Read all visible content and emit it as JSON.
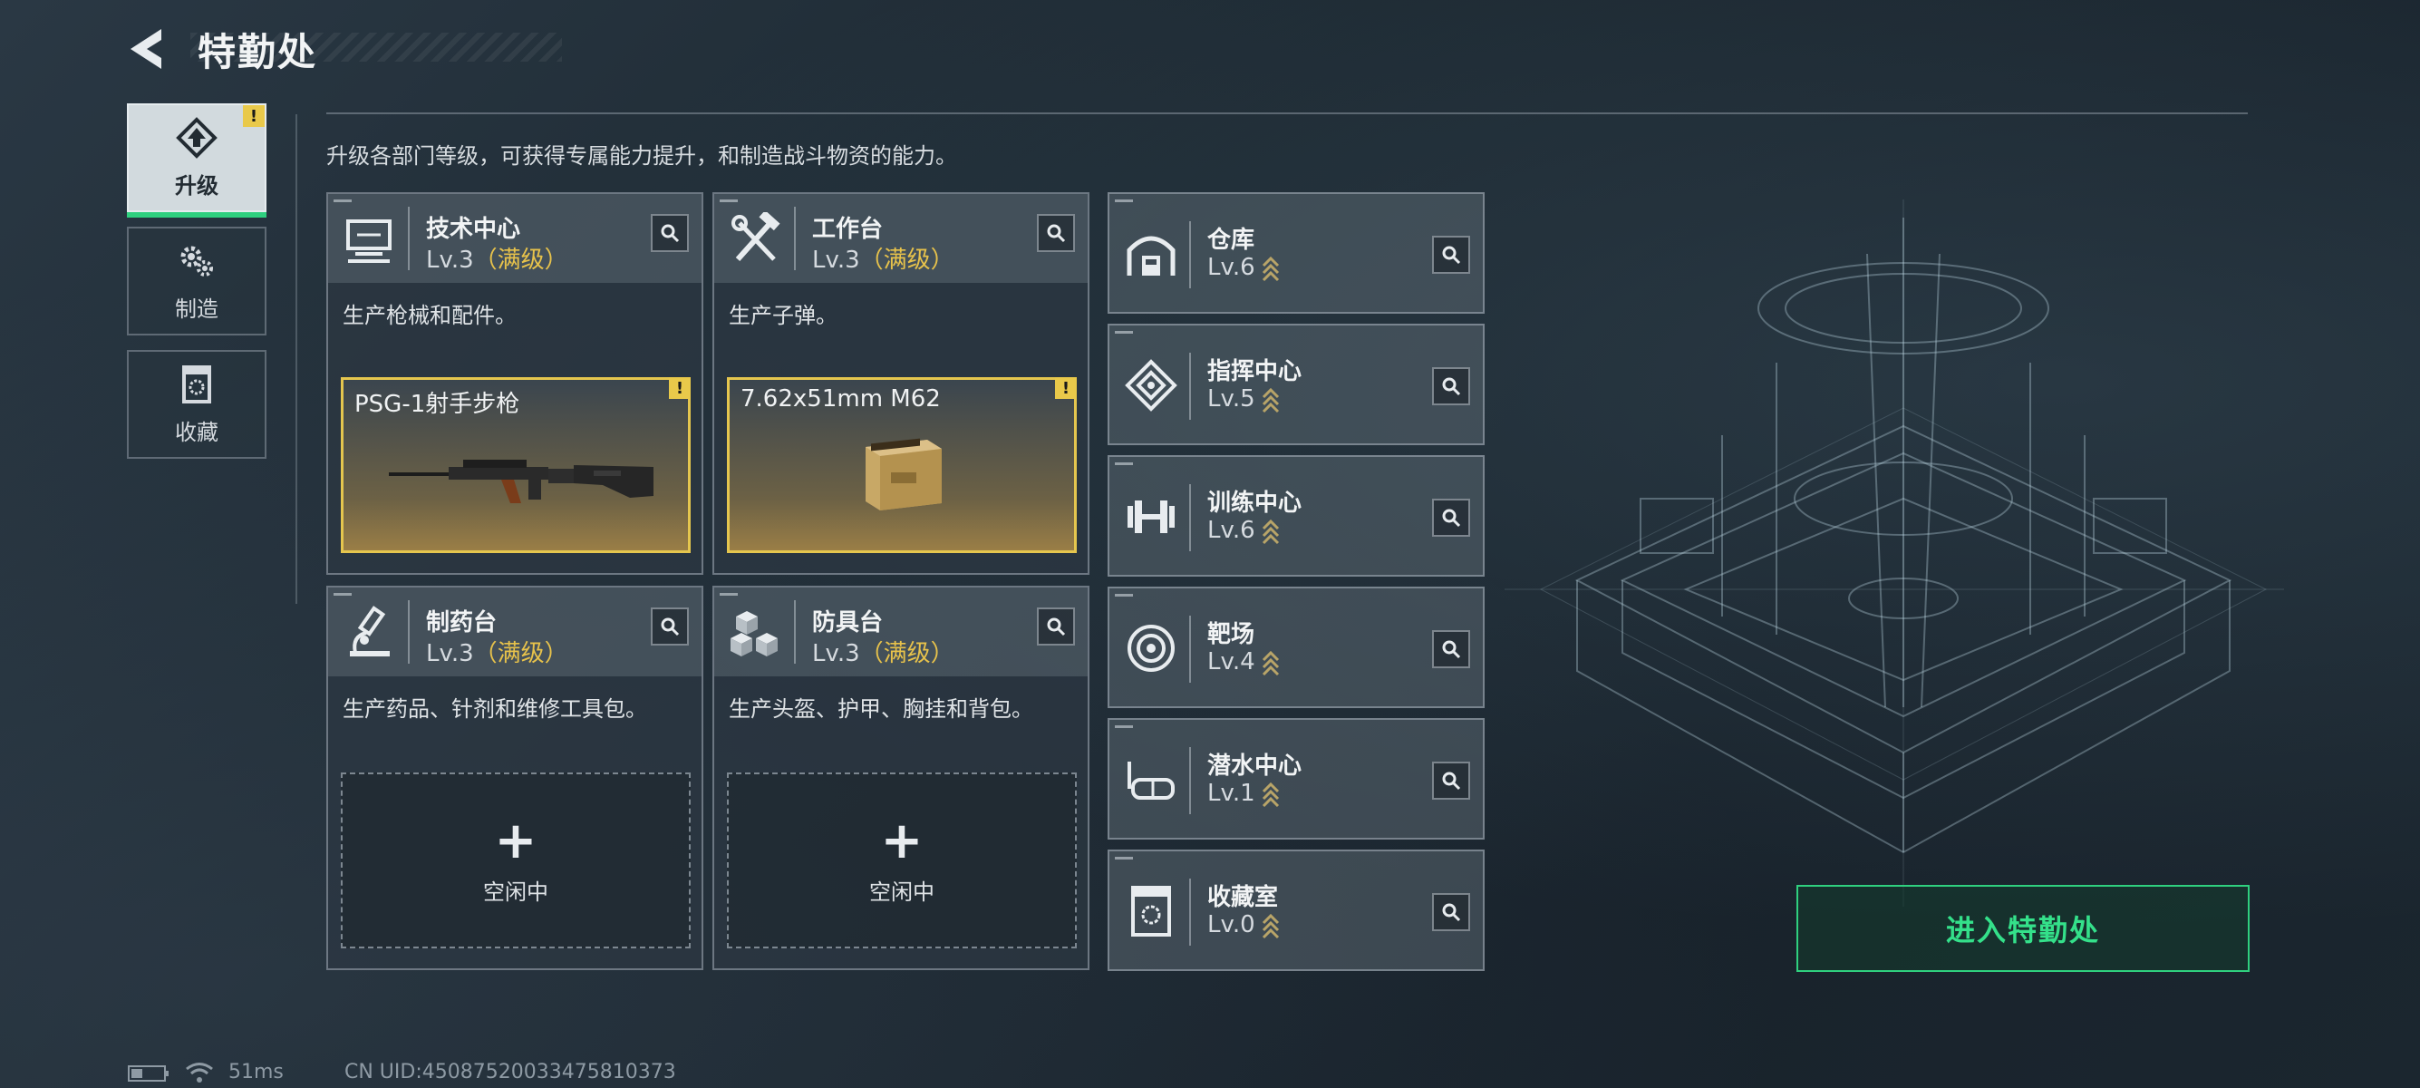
{
  "header": {
    "title": "特勤处"
  },
  "tabs": [
    {
      "label": "升级",
      "icon": "upgrade-icon",
      "active": true,
      "badge": "!"
    },
    {
      "label": "制造",
      "icon": "gears-icon",
      "active": false
    },
    {
      "label": "收藏",
      "icon": "collection-icon",
      "active": false
    }
  ],
  "description": "升级各部门等级，可获得专属能力提升，和制造战斗物资的能力。",
  "departments": [
    {
      "name": "技术中心",
      "level": "Lv.3",
      "maxed": "（满级）",
      "desc": "生产枪械和配件。",
      "product": "PSG-1射手步枪",
      "badge": "!",
      "icon": "computer-icon"
    },
    {
      "name": "工作台",
      "level": "Lv.3",
      "maxed": "（满级）",
      "desc": "生产子弹。",
      "product": "7.62x51mm M62",
      "badge": "!",
      "icon": "tools-icon"
    },
    {
      "name": "制药台",
      "level": "Lv.3",
      "maxed": "（满级）",
      "desc": "生产药品、针剂和维修工具包。",
      "idle_plus": "+",
      "idle": "空闲中",
      "icon": "microscope-icon"
    },
    {
      "name": "防具台",
      "level": "Lv.3",
      "maxed": "（满级）",
      "desc": "生产头盔、护甲、胸挂和背包。",
      "idle_plus": "+",
      "idle": "空闲中",
      "icon": "blocks-icon"
    }
  ],
  "facilities": [
    {
      "name": "仓库",
      "level": "Lv.6",
      "icon": "warehouse-icon"
    },
    {
      "name": "指挥中心",
      "level": "Lv.5",
      "icon": "command-icon"
    },
    {
      "name": "训练中心",
      "level": "Lv.6",
      "icon": "dumbbell-icon"
    },
    {
      "name": "靶场",
      "level": "Lv.4",
      "icon": "target-icon"
    },
    {
      "name": "潜水中心",
      "level": "Lv.1",
      "icon": "goggles-icon"
    },
    {
      "name": "收藏室",
      "level": "Lv.0",
      "icon": "collection-icon"
    }
  ],
  "enter_button": "进入特勤处",
  "status": {
    "ping": "51ms",
    "uid": "CN UID:450875200334758103​73"
  },
  "colors": {
    "accent_green": "#2fd07f",
    "maxed_gold": "#e7c24b",
    "upgrade_chevron": "#b8a468"
  }
}
